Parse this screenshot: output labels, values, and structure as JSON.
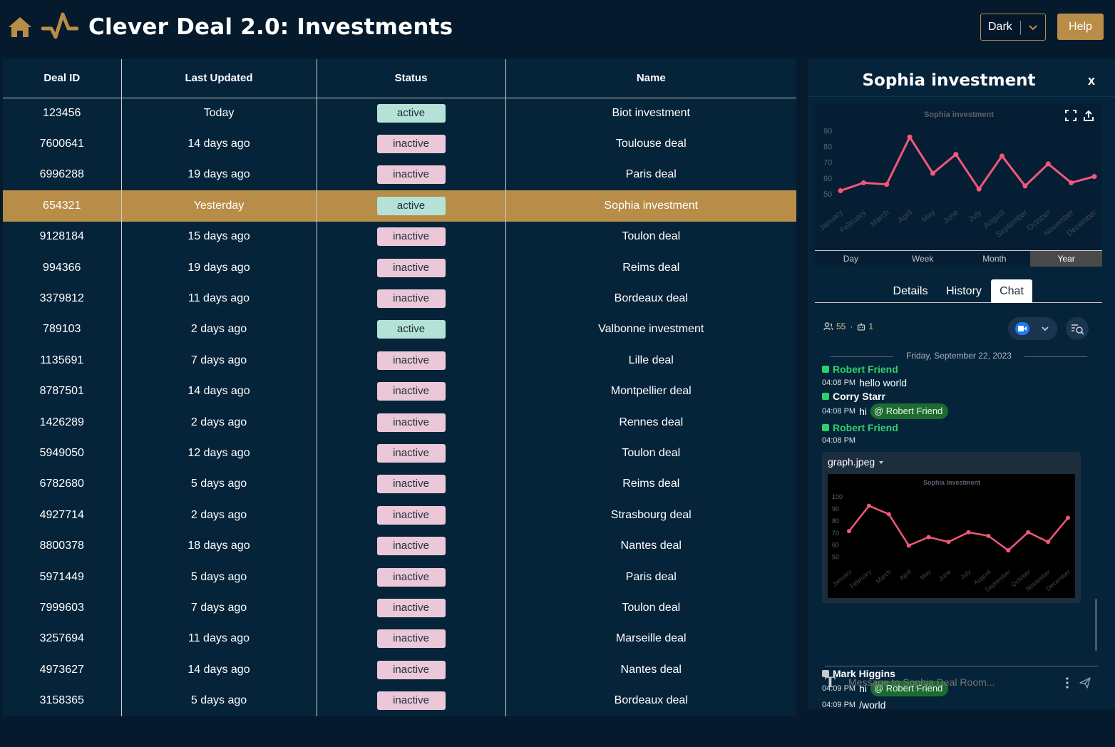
{
  "header": {
    "title": "Clever Deal 2.0: Investments",
    "home_icon": "home-icon",
    "logo_icon": "pulse-icon",
    "theme_value": "Dark",
    "help_label": "Help"
  },
  "colors": {
    "background": "#061a2e",
    "panel": "#05243a",
    "accent": "#b88d48",
    "active_badge": "#b4e2d6",
    "inactive_badge": "#ebc8d8",
    "chart_line": "#f2587a",
    "mention_bg": "#1e6b32",
    "online": "#2fcf6a"
  },
  "table": {
    "columns": [
      "Deal ID",
      "Last Updated",
      "Status",
      "Name"
    ],
    "selected_index": 3,
    "rows": [
      {
        "id": "123456",
        "updated": "Today",
        "status": "active",
        "name": "Biot investment"
      },
      {
        "id": "7600641",
        "updated": "14 days ago",
        "status": "inactive",
        "name": "Toulouse deal"
      },
      {
        "id": "6996288",
        "updated": "19 days ago",
        "status": "inactive",
        "name": "Paris deal"
      },
      {
        "id": "654321",
        "updated": "Yesterday",
        "status": "active",
        "name": "Sophia investment"
      },
      {
        "id": "9128184",
        "updated": "15 days ago",
        "status": "inactive",
        "name": "Toulon deal"
      },
      {
        "id": "994366",
        "updated": "19 days ago",
        "status": "inactive",
        "name": "Reims deal"
      },
      {
        "id": "3379812",
        "updated": "11 days ago",
        "status": "inactive",
        "name": "Bordeaux deal"
      },
      {
        "id": "789103",
        "updated": "2 days ago",
        "status": "active",
        "name": "Valbonne investment"
      },
      {
        "id": "1135691",
        "updated": "7 days ago",
        "status": "inactive",
        "name": "Lille deal"
      },
      {
        "id": "8787501",
        "updated": "14 days ago",
        "status": "inactive",
        "name": "Montpellier deal"
      },
      {
        "id": "1426289",
        "updated": "2 days ago",
        "status": "inactive",
        "name": "Rennes deal"
      },
      {
        "id": "5949050",
        "updated": "12 days ago",
        "status": "inactive",
        "name": "Toulon deal"
      },
      {
        "id": "6782680",
        "updated": "5 days ago",
        "status": "inactive",
        "name": "Reims deal"
      },
      {
        "id": "4927714",
        "updated": "2 days ago",
        "status": "inactive",
        "name": "Strasbourg deal"
      },
      {
        "id": "8800378",
        "updated": "18 days ago",
        "status": "inactive",
        "name": "Nantes deal"
      },
      {
        "id": "5971449",
        "updated": "5 days ago",
        "status": "inactive",
        "name": "Paris deal"
      },
      {
        "id": "7999603",
        "updated": "7 days ago",
        "status": "inactive",
        "name": "Toulon deal"
      },
      {
        "id": "3257694",
        "updated": "11 days ago",
        "status": "inactive",
        "name": "Marseille deal"
      },
      {
        "id": "4973627",
        "updated": "14 days ago",
        "status": "inactive",
        "name": "Nantes deal"
      },
      {
        "id": "3158365",
        "updated": "5 days ago",
        "status": "inactive",
        "name": "Bordeaux deal"
      }
    ]
  },
  "side": {
    "title": "Sophia investment",
    "close_label": "x",
    "chart_icons": [
      "expand-icon",
      "share-icon"
    ],
    "range_tabs": [
      "Day",
      "Week",
      "Month",
      "Year"
    ],
    "range_selected": "Year",
    "tabs": [
      "Details",
      "History",
      "Chat"
    ],
    "tab_selected": "Chat",
    "members_count": "55",
    "bots_count": "1",
    "search_icon": "search-list-icon"
  },
  "chat": {
    "date": "Friday, September 22, 2023",
    "messages": [
      {
        "author": "Robert Friend",
        "time": "04:08 PM",
        "text": "hello world"
      },
      {
        "author": "Corry Starr",
        "time": "04:08 PM",
        "text": "hi",
        "mention": "@ Robert Friend"
      },
      {
        "author": "Robert Friend",
        "time": "04:08 PM",
        "attachment": "graph.jpeg"
      },
      {
        "author": "Mark Higgins",
        "time": "04:09 PM",
        "text": "hi",
        "mention": "@ Robert Friend"
      },
      {
        "time": "04:09 PM",
        "text": "/world"
      }
    ],
    "composer_placeholder": "Message to Sophia Deal Room..."
  },
  "chart_data": [
    {
      "type": "line",
      "title": "Sophia investment",
      "categories": [
        "January",
        "February",
        "March",
        "April",
        "May",
        "June",
        "July",
        "August",
        "September",
        "October",
        "November",
        "December"
      ],
      "values": [
        52,
        57,
        56,
        86,
        63,
        75,
        53,
        74,
        55,
        69,
        57,
        61
      ],
      "yticks": [
        50,
        60,
        70,
        80,
        90
      ],
      "ylim": [
        45,
        92
      ]
    },
    {
      "type": "line",
      "title": "Sophia investment",
      "categories": [
        "January",
        "February",
        "March",
        "April",
        "May",
        "June",
        "July",
        "August",
        "September",
        "October",
        "November",
        "December"
      ],
      "values": [
        71,
        92,
        85,
        59,
        66,
        62,
        70,
        67,
        55,
        70,
        62,
        82
      ],
      "yticks": [
        50,
        60,
        70,
        80,
        90,
        100
      ],
      "ylim": [
        45,
        103
      ]
    }
  ]
}
